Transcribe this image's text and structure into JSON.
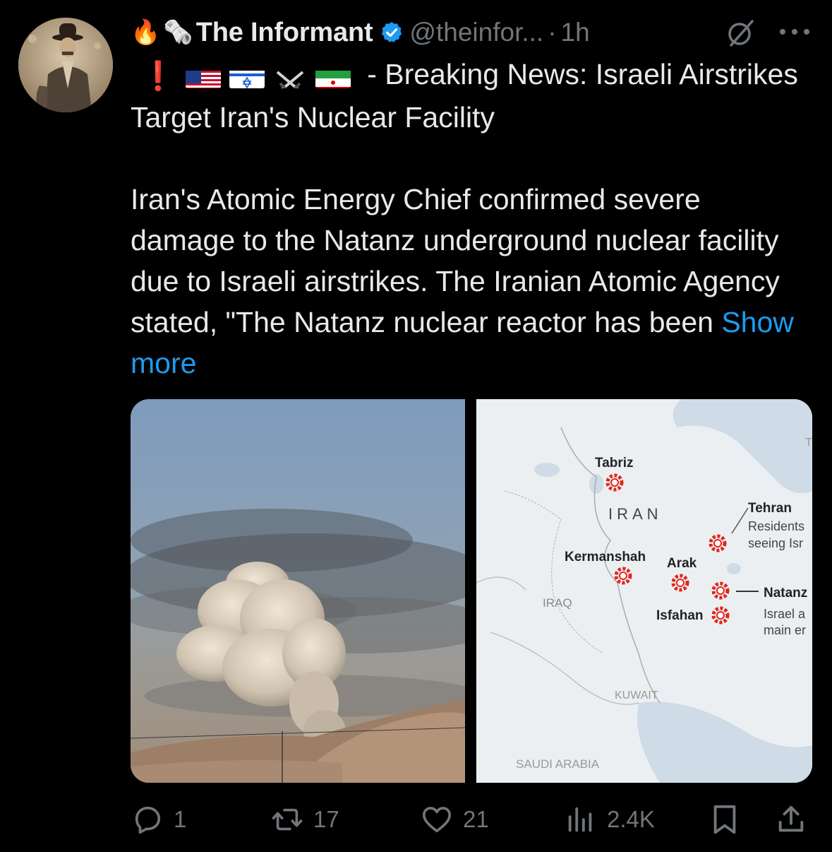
{
  "author": {
    "name": "The Informant",
    "handle": "@theinfor...",
    "separator": "·",
    "time": "1h",
    "lead_emoji": [
      "🔥",
      "🗞️"
    ]
  },
  "tweet": {
    "line1_emoji": [
      "❗",
      "us-flag",
      "israel-flag",
      "⚔️",
      "iran-flag"
    ],
    "headline": " - Breaking News: Israeli Airstrikes Target Iran's Nuclear Facility",
    "body": "Iran's Atomic Energy Chief confirmed severe damage to the Natanz underground nuclear facility due to Israeli airstrikes. The Iranian Atomic Agency stated, \"The Natanz nuclear reactor has been ",
    "show_more": "Show more"
  },
  "map": {
    "labels": {
      "tabriz": "Tabriz",
      "iran": "IRAN",
      "tehran": "Tehran",
      "residents": "Residents",
      "seeing": "seeing Isr",
      "kermanshah": "Kermanshah",
      "arak": "Arak",
      "natanz": "Natanz",
      "israel_a": "Israel a",
      "main_er": "main er",
      "iraq": "IRAQ",
      "isfahan": "Isfahan",
      "kuwait": "KUWAIT",
      "saudi": "SAUDI ARABIA",
      "t": "T"
    }
  },
  "actions": {
    "replies": "1",
    "reposts": "17",
    "likes": "21",
    "views": "2.4K"
  },
  "colors": {
    "background": "#000000",
    "text": "#e7e9ea",
    "muted": "#71767b",
    "link": "#1d9bf0",
    "strike_marker": "#e0261b"
  }
}
